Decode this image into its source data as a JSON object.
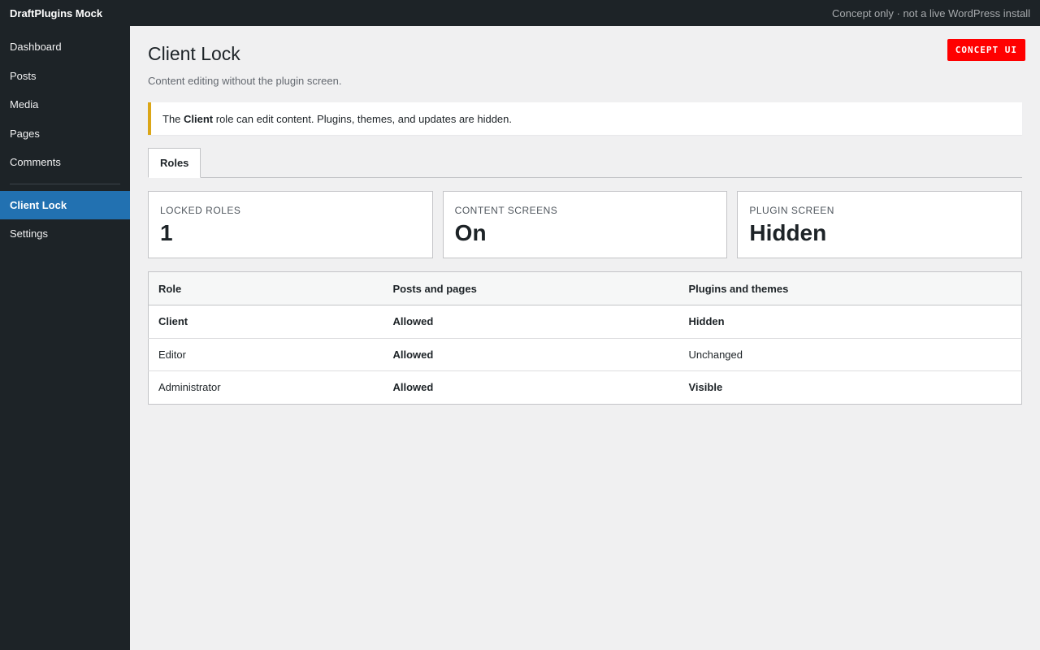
{
  "topbar": {
    "brand": "DraftPlugins Mock",
    "note": "Concept only · not a live WordPress install"
  },
  "sidebar": {
    "items": [
      {
        "label": "Dashboard"
      },
      {
        "label": "Posts"
      },
      {
        "label": "Media"
      },
      {
        "label": "Pages"
      },
      {
        "label": "Comments"
      }
    ],
    "plugin_items": [
      {
        "label": "Client Lock",
        "active": true
      },
      {
        "label": "Settings"
      }
    ]
  },
  "badge": "CONCEPT UI",
  "page": {
    "title": "Client Lock",
    "subtitle": "Content editing without the plugin screen."
  },
  "notice": {
    "prefix": "The ",
    "emphasis": "Client",
    "suffix": " role can edit content. Plugins, themes, and updates are hidden."
  },
  "tabs": [
    {
      "label": "Roles"
    }
  ],
  "cards": [
    {
      "label": "LOCKED ROLES",
      "value": "1"
    },
    {
      "label": "CONTENT SCREENS",
      "value": "On"
    },
    {
      "label": "PLUGIN SCREEN",
      "value": "Hidden"
    }
  ],
  "table": {
    "headers": [
      "Role",
      "Posts and pages",
      "Plugins and themes"
    ],
    "rows": [
      [
        "Client",
        "Allowed",
        "Hidden"
      ],
      [
        "Editor",
        "Allowed",
        "Unchanged"
      ],
      [
        "Administrator",
        "Allowed",
        "Visible"
      ]
    ]
  },
  "colors": {
    "accent": "#2271b1",
    "notice_border": "#dba617",
    "allowed": "#00a32a",
    "hidden": "#d63638",
    "badge": "#ff0000"
  }
}
